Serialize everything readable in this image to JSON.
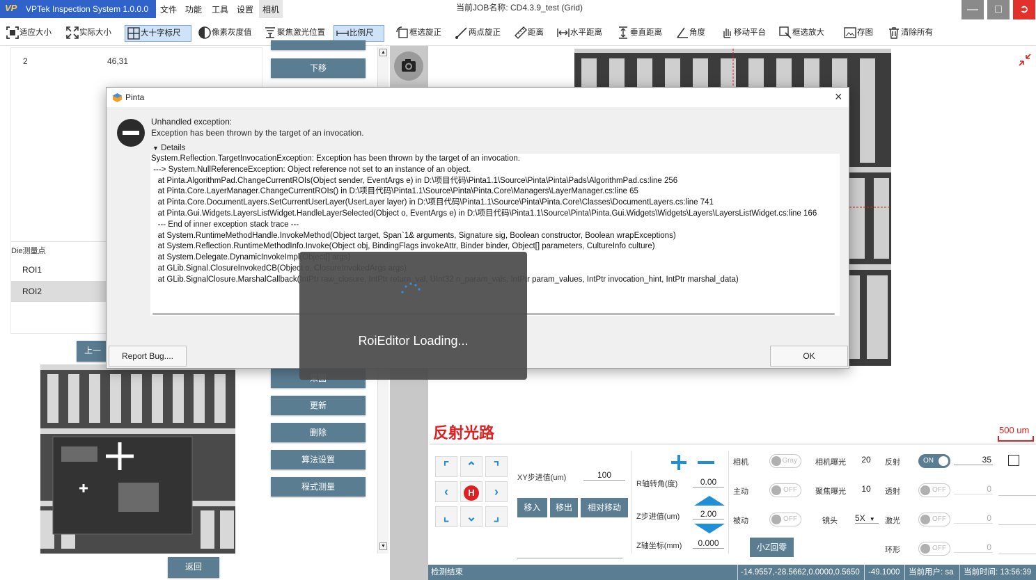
{
  "app": {
    "logo": "VP",
    "title": "VPTek Inspection System 1.0.0.0",
    "menu": [
      "文件",
      "功能",
      "工具",
      "设置",
      "相机"
    ],
    "job_title": "当前JOB名称:  CD4.3.9_test (Grid)"
  },
  "toolbar": [
    {
      "label": "适应大小",
      "icon": "fit-icon"
    },
    {
      "label": "实际大小",
      "icon": "expand-icon"
    },
    {
      "label": "大十字标尺",
      "icon": "crosshair-icon"
    },
    {
      "label": "像素灰度值",
      "icon": "contrast-icon"
    },
    {
      "label": "聚焦激光位置",
      "icon": "laser-icon"
    },
    {
      "label": "比例尺",
      "icon": "scale-icon"
    },
    {
      "label": "框选旋正",
      "icon": "rotate-icon"
    },
    {
      "label": "两点旋正",
      "icon": "line-icon"
    },
    {
      "label": "距离",
      "icon": "ruler-icon"
    },
    {
      "label": "水平距离",
      "icon": "hdistance-icon"
    },
    {
      "label": "垂直距离",
      "icon": "vdistance-icon"
    },
    {
      "label": "角度",
      "icon": "angle-icon"
    },
    {
      "label": "移动平台",
      "icon": "hand-icon"
    },
    {
      "label": "框选放大",
      "icon": "zoom-box-icon"
    },
    {
      "label": "存图",
      "icon": "image-icon"
    },
    {
      "label": "清除所有",
      "icon": "trash-icon"
    }
  ],
  "left": {
    "row": {
      "index": "2",
      "value": "46,31"
    },
    "die_label": "Die测量点",
    "rois": [
      "ROI1",
      "ROI2"
    ],
    "prev_button": "上一",
    "back_button": "返回"
  },
  "side_buttons": {
    "down": "下移",
    "capture": "采图",
    "update": "更新",
    "delete": "删除",
    "algo": "算法设置",
    "measure": "程式测量"
  },
  "dialog": {
    "title": "Pinta",
    "message1": "Unhandled exception:",
    "message2": "Exception has been thrown by the target of an invocation.",
    "details_label": "Details",
    "trace": [
      "System.Reflection.TargetInvocationException: Exception has been thrown by the target of an invocation.",
      " ---> System.NullReferenceException: Object reference not set to an instance of an object.",
      "   at Pinta.AlgorithmPad.ChangeCurrentROIs(Object sender, EventArgs e) in D:\\项目代码\\Pinta1.1\\Source\\Pinta\\Pinta\\Pads\\AlgorithmPad.cs:line 256",
      "   at Pinta.Core.LayerManager.ChangeCurrentROIs() in D:\\项目代码\\Pinta1.1\\Source\\Pinta\\Pinta.Core\\Managers\\LayerManager.cs:line 65",
      "   at Pinta.Core.DocumentLayers.SetCurrentUserLayer(UserLayer layer) in D:\\项目代码\\Pinta1.1\\Source\\Pinta\\Pinta.Core\\Classes\\DocumentLayers.cs:line 741",
      "   at Pinta.Gui.Widgets.LayersListWidget.HandleLayerSelected(Object o, EventArgs e) in D:\\项目代码\\Pinta1.1\\Source\\Pinta\\Pinta.Gui.Widgets\\Widgets\\Layers\\LayersListWidget.cs:line 166",
      "   --- End of inner exception stack trace ---",
      "   at System.RuntimeMethodHandle.InvokeMethod(Object target, Span`1& arguments, Signature sig, Boolean constructor, Boolean wrapExceptions)",
      "   at System.Reflection.RuntimeMethodInfo.Invoke(Object obj, BindingFlags invokeAttr, Binder binder, Object[] parameters, CultureInfo culture)",
      "   at System.Delegate.DynamicInvokeImpl(Object[] args)",
      "   at GLib.Signal.ClosureInvokedCB(Object o, ClosureInvokedArgs args)",
      "   at GLib.SignalClosure.MarshalCallback(IntPtr raw_closure, IntPtr return_val, UInt32 n_param_vals, IntPtr param_values, IntPtr invocation_hint, IntPtr marshal_data)"
    ],
    "report_button": "Report Bug....",
    "ok_button": "OK"
  },
  "loading": {
    "text": "RoiEditor Loading..."
  },
  "optical": {
    "title": "反射光路",
    "scale": "500 um",
    "home": "H",
    "xy_step_label": "XY步进值(um)",
    "xy_step_value": "100",
    "move_in": "移入",
    "move_out": "移出",
    "rel_move": "相对移动",
    "r_rot_label": "R轴转角(度)",
    "r_rot_value": "0.00",
    "z_step_label": "Z步进值(um)",
    "z_step_value": "2.00",
    "z_coord_label": "Z轴坐标(mm)",
    "z_coord_value": "0.000",
    "z_home": "小Z回零",
    "camera_label": "相机",
    "camera_toggle": "Gray",
    "active_label": "主动",
    "active_toggle": "OFF",
    "passive_label": "被动",
    "passive_toggle": "OFF",
    "exposure_label": "相机曝光",
    "exposure_value": "20",
    "focus_exposure_label": "聚焦曝光",
    "focus_exposure_value": "10",
    "lens_label": "镜头",
    "lens_value": "5X",
    "reflect_label": "反射",
    "reflect_toggle": "ON",
    "reflect_value": "35",
    "transmit_label": "透射",
    "transmit_toggle": "OFF",
    "transmit_value": "0",
    "laser_label": "激光",
    "laser_toggle": "OFF",
    "laser_value": "0",
    "ring_label": "环形",
    "ring_toggle": "OFF",
    "ring_value": "0"
  },
  "status": {
    "left": "检测结束",
    "coords": "-14.9557,-28.5662,0.0000,0.5650",
    "z": "-49.1000",
    "user": "当前用户:  sa",
    "time": "当前时间:  13:56:39"
  }
}
